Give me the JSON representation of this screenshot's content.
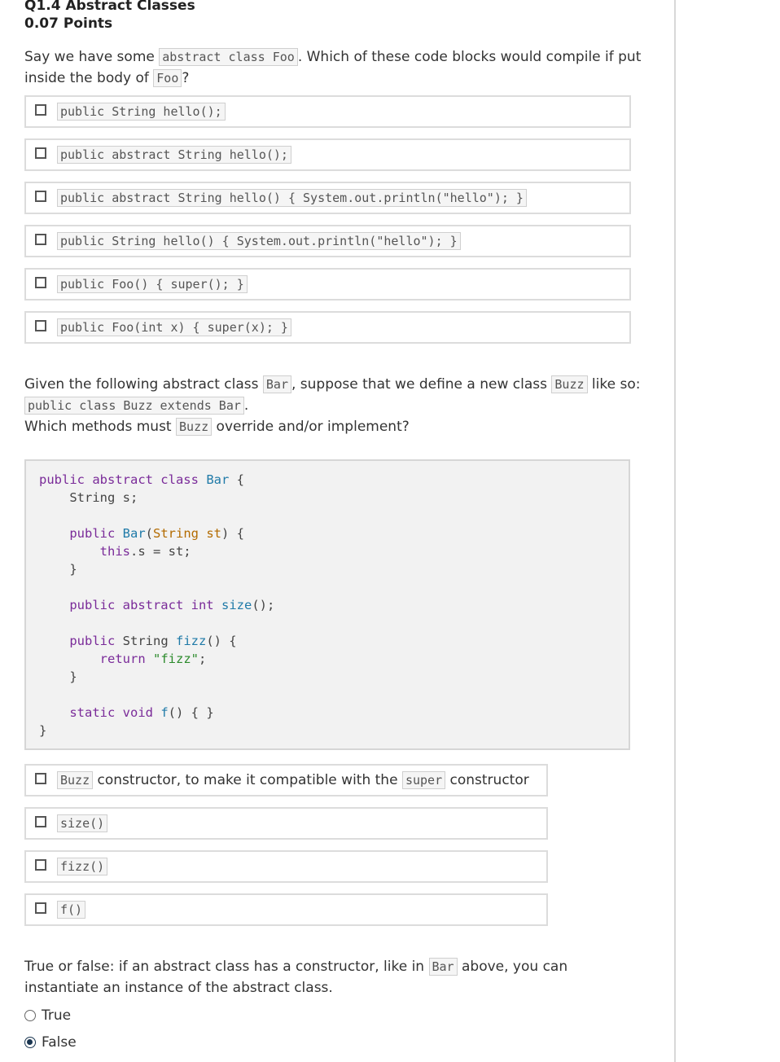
{
  "question": {
    "title": "Q1.4 Abstract Classes",
    "points": "0.07 Points"
  },
  "part1": {
    "prompt_a": "Say we have some ",
    "prompt_code1": "abstract class Foo",
    "prompt_b": ". Which of these code blocks would compile if put inside the body of ",
    "prompt_code2": "Foo",
    "prompt_c": "?",
    "options": [
      "public String hello();",
      "public abstract String hello();",
      "public abstract String hello() { System.out.println(\"hello\"); }",
      "public String hello() { System.out.println(\"hello\"); }",
      "public Foo() { super(); }",
      "public Foo(int x) { super(x); }"
    ]
  },
  "part2": {
    "p1": "Given the following abstract class ",
    "c1": "Bar",
    "p2": ", suppose that we define a new class ",
    "c2": "Buzz",
    "p3": " like so: ",
    "c3": "public class Buzz extends Bar",
    "p4": ".",
    "p5": "Which methods must ",
    "c4": "Buzz",
    "p6": " override and/or implement?",
    "code": {
      "l1a": "public abstract class",
      "l1b": "Bar",
      "l1c": " {",
      "l2": "    String s;",
      "l4a": "    public",
      "l4b": "Bar",
      "l4c": "(",
      "l4d": "String st",
      "l4e": ") {",
      "l5a": "        this",
      "l5b": ".s = st;",
      "l6": "    }",
      "l8a": "    public abstract int",
      "l8b": "size",
      "l8c": "();",
      "l10a": "    public",
      "l10b": " String ",
      "l10c": "fizz",
      "l10d": "() {",
      "l11a": "        return",
      "l11b": "\"fizz\"",
      "l11c": ";",
      "l12": "    }",
      "l14a": "    static void",
      "l14b": "f",
      "l14c": "() { }",
      "l15": "}"
    },
    "opt1_code1": "Buzz",
    "opt1_text1": " constructor, to make it compatible with the ",
    "opt1_code2": "super",
    "opt1_text2": " constructor",
    "opt2": "size()",
    "opt3": "fizz()",
    "opt4": "f()"
  },
  "part3": {
    "p1": "True or false: if an abstract class has a constructor, like in ",
    "c1": "Bar",
    "p2": " above, you can instantiate an instance of the abstract class.",
    "opt_true": "True",
    "opt_false": "False",
    "selected": "False"
  }
}
